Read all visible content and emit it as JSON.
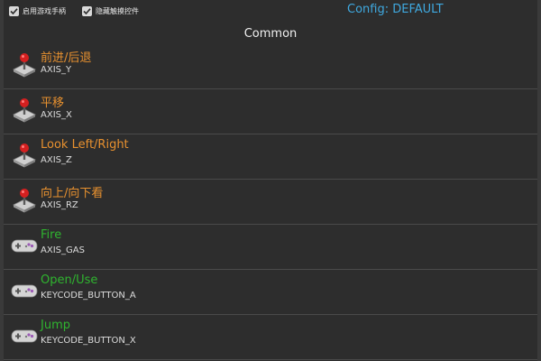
{
  "topbar": {
    "checkbox1": {
      "label": "启用游戏手柄",
      "checked": true
    },
    "checkbox2": {
      "label": "隐藏触摸控件",
      "checked": true
    },
    "config_label": "Config: DEFAULT"
  },
  "section": {
    "title": "Common"
  },
  "colors": {
    "axis_title": "#e8912f",
    "button_title": "#2fb52f",
    "config_accent": "#3fa9e0"
  },
  "mappings": [
    {
      "label": "前进/后退",
      "binding": "AXIS_Y",
      "icon": "joystick-icon",
      "kind": "axis"
    },
    {
      "label": "平移",
      "binding": "AXIS_X",
      "icon": "joystick-icon",
      "kind": "axis"
    },
    {
      "label": "Look Left/Right",
      "binding": "AXIS_Z",
      "icon": "joystick-icon",
      "kind": "axis"
    },
    {
      "label": "向上/向下看",
      "binding": "AXIS_RZ",
      "icon": "joystick-icon",
      "kind": "axis"
    },
    {
      "label": "Fire",
      "binding": "AXIS_GAS",
      "icon": "gamepad-icon",
      "kind": "button"
    },
    {
      "label": "Open/Use",
      "binding": "KEYCODE_BUTTON_A",
      "icon": "gamepad-icon",
      "kind": "button"
    },
    {
      "label": "Jump",
      "binding": "KEYCODE_BUTTON_X",
      "icon": "gamepad-icon",
      "kind": "button"
    }
  ]
}
